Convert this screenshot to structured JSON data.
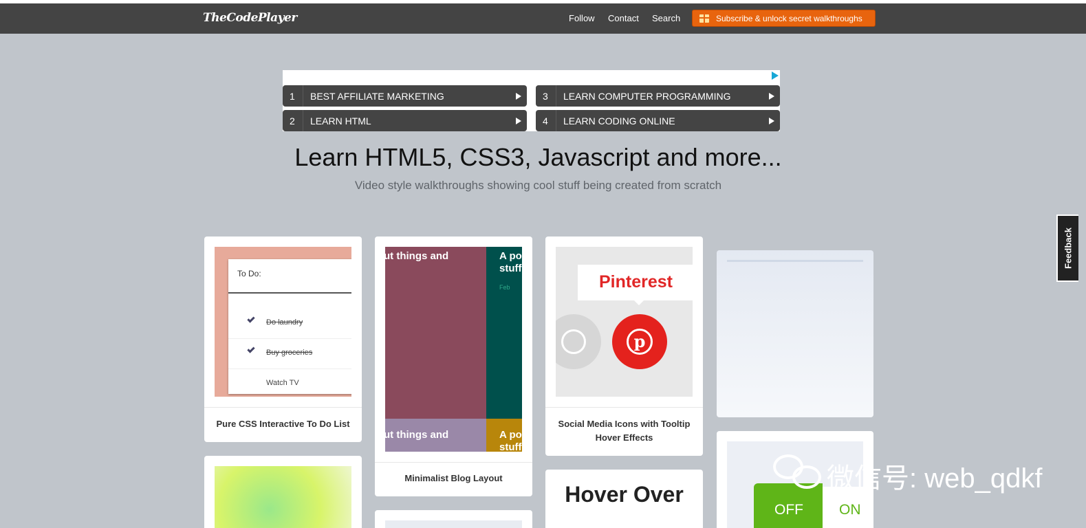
{
  "header": {
    "logo": "TheCodePlayer",
    "nav": [
      "Follow",
      "Contact",
      "Search"
    ],
    "subscribe_label": "Subscribe & unlock secret walkthroughs",
    "subscribe_icon": "gift-icon"
  },
  "ad": {
    "items": [
      {
        "num": "1",
        "label": "BEST AFFILIATE MARKETING"
      },
      {
        "num": "2",
        "label": "LEARN HTML"
      },
      {
        "num": "3",
        "label": "LEARN COMPUTER PROGRAMMING"
      },
      {
        "num": "4",
        "label": "LEARN CODING ONLINE"
      }
    ]
  },
  "hero": {
    "title": "Learn HTML5, CSS3, Javascript and more...",
    "subtitle": "Video style walkthroughs showing cool stuff being created from scratch"
  },
  "cards": [
    {
      "title": "Pure CSS Interactive To Do List",
      "thumb": {
        "heading": "To Do:",
        "items": [
          {
            "text": "Do laundry",
            "done": true
          },
          {
            "text": "Buy groceries",
            "done": true
          },
          {
            "text": "Watch TV",
            "done": false
          }
        ]
      }
    },
    {
      "title": "Minimalist Blog Layout",
      "thumb": {
        "text_a": "ut things and",
        "text_b": "A po",
        "text_b2": "stuff",
        "date": "Feb",
        "text_c": "ut things and",
        "text_d": "A po",
        "text_d2": "stuff"
      }
    },
    {
      "title_line1": "Social Media Icons with Tooltip",
      "title_line2": "Hover Effects",
      "thumb": {
        "tooltip": "Pinterest",
        "pin_letter": "p"
      }
    },
    {
      "title": ""
    },
    {
      "title": ""
    },
    {
      "title": ""
    },
    {
      "thumb": {
        "text": "Hover Over"
      }
    },
    {
      "thumb": {
        "off": "OFF",
        "on": "ON"
      }
    }
  ],
  "feedback_label": "Feedback",
  "watermark": "微信号: web_qdkf",
  "colors": {
    "page_bg": "#c0c5cb",
    "navbar": "#444444",
    "subscribe": "#e8640e",
    "pinterest": "#e4221d",
    "toggle_green": "#5fb518"
  }
}
